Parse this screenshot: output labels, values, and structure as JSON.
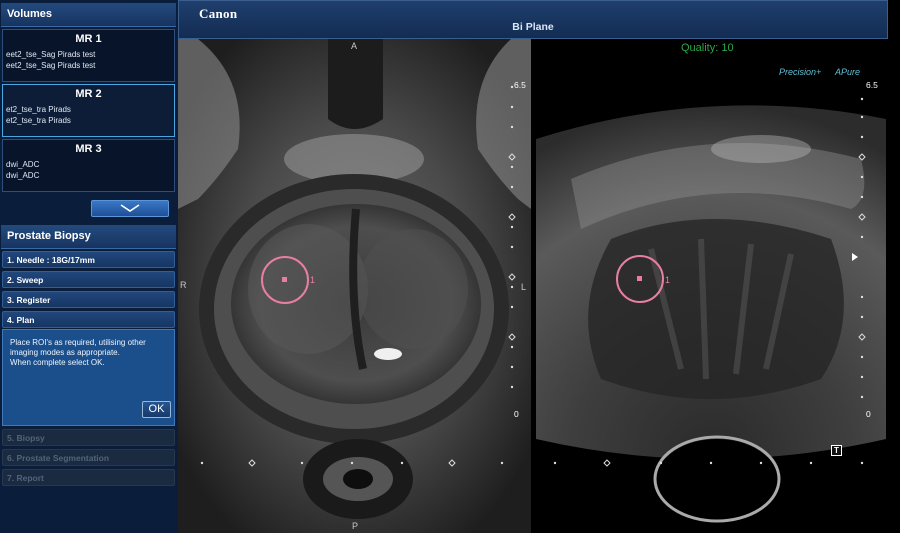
{
  "volumes": {
    "title": "Volumes",
    "items": [
      {
        "header": "MR 1",
        "lines": [
          "eet2_tse_Sag Pirads test",
          "eet2_tse_Sag Pirads test"
        ]
      },
      {
        "header": "MR 2",
        "lines": [
          "et2_tse_tra Pirads",
          "et2_tse_tra Pirads"
        ]
      },
      {
        "header": "MR 3",
        "lines": [
          "dwi_ADC",
          "dwi_ADC"
        ]
      }
    ],
    "scroll_icon": "chevron-down-icon"
  },
  "biopsy": {
    "title": "Prostate Biopsy",
    "steps": [
      {
        "label": "1. Needle : 18G/17mm"
      },
      {
        "label": "2. Sweep"
      },
      {
        "label": "3. Register"
      },
      {
        "label": "4. Plan"
      },
      {
        "label": "5. Biopsy"
      },
      {
        "label": "6. Prostate Segmentation"
      },
      {
        "label": "7. Report"
      }
    ],
    "plan_text_lines": [
      "Place ROI's as required, utilising other",
      "imaging modes as appropriate.",
      "When complete select OK."
    ],
    "ok_label": "OK"
  },
  "header": {
    "brand": "Canon",
    "view_title": "Bi Plane"
  },
  "mr_view": {
    "orient_top": "A",
    "orient_bottom": "P",
    "orient_left": "R",
    "orient_right": "L",
    "depth_top": "6.5",
    "depth_bottom": "0",
    "roi_label": "1"
  },
  "us_view": {
    "quality": "Quality: 10",
    "precision": "Precision+",
    "apure": "APure",
    "depth_top": "6.5",
    "depth_bottom": "0",
    "roi_label": "1",
    "marker": "T"
  },
  "colors": {
    "panel_bg": "#0a1d3a",
    "roi": "#e87fa2",
    "quality": "#2ba84a",
    "accent": "#49a6e0"
  }
}
